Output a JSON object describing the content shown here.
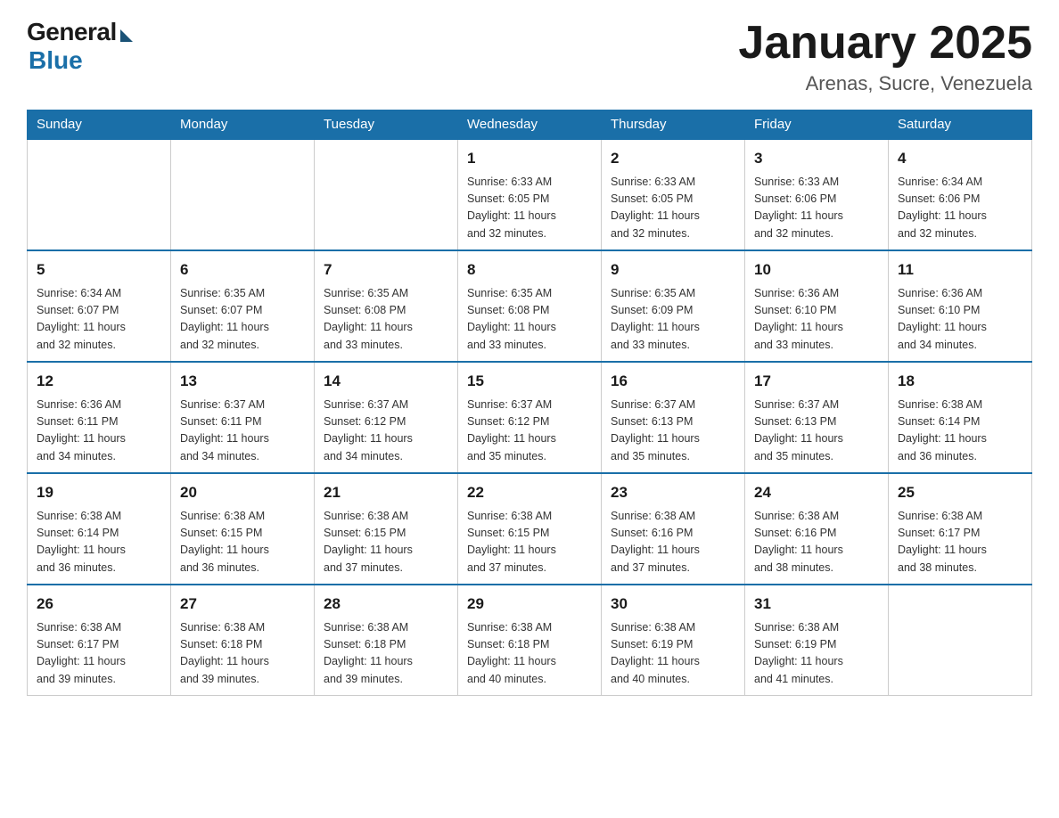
{
  "logo": {
    "general": "General",
    "blue": "Blue"
  },
  "title": "January 2025",
  "location": "Arenas, Sucre, Venezuela",
  "days_of_week": [
    "Sunday",
    "Monday",
    "Tuesday",
    "Wednesday",
    "Thursday",
    "Friday",
    "Saturday"
  ],
  "weeks": [
    [
      {
        "day": "",
        "info": ""
      },
      {
        "day": "",
        "info": ""
      },
      {
        "day": "",
        "info": ""
      },
      {
        "day": "1",
        "info": "Sunrise: 6:33 AM\nSunset: 6:05 PM\nDaylight: 11 hours\nand 32 minutes."
      },
      {
        "day": "2",
        "info": "Sunrise: 6:33 AM\nSunset: 6:05 PM\nDaylight: 11 hours\nand 32 minutes."
      },
      {
        "day": "3",
        "info": "Sunrise: 6:33 AM\nSunset: 6:06 PM\nDaylight: 11 hours\nand 32 minutes."
      },
      {
        "day": "4",
        "info": "Sunrise: 6:34 AM\nSunset: 6:06 PM\nDaylight: 11 hours\nand 32 minutes."
      }
    ],
    [
      {
        "day": "5",
        "info": "Sunrise: 6:34 AM\nSunset: 6:07 PM\nDaylight: 11 hours\nand 32 minutes."
      },
      {
        "day": "6",
        "info": "Sunrise: 6:35 AM\nSunset: 6:07 PM\nDaylight: 11 hours\nand 32 minutes."
      },
      {
        "day": "7",
        "info": "Sunrise: 6:35 AM\nSunset: 6:08 PM\nDaylight: 11 hours\nand 33 minutes."
      },
      {
        "day": "8",
        "info": "Sunrise: 6:35 AM\nSunset: 6:08 PM\nDaylight: 11 hours\nand 33 minutes."
      },
      {
        "day": "9",
        "info": "Sunrise: 6:35 AM\nSunset: 6:09 PM\nDaylight: 11 hours\nand 33 minutes."
      },
      {
        "day": "10",
        "info": "Sunrise: 6:36 AM\nSunset: 6:10 PM\nDaylight: 11 hours\nand 33 minutes."
      },
      {
        "day": "11",
        "info": "Sunrise: 6:36 AM\nSunset: 6:10 PM\nDaylight: 11 hours\nand 34 minutes."
      }
    ],
    [
      {
        "day": "12",
        "info": "Sunrise: 6:36 AM\nSunset: 6:11 PM\nDaylight: 11 hours\nand 34 minutes."
      },
      {
        "day": "13",
        "info": "Sunrise: 6:37 AM\nSunset: 6:11 PM\nDaylight: 11 hours\nand 34 minutes."
      },
      {
        "day": "14",
        "info": "Sunrise: 6:37 AM\nSunset: 6:12 PM\nDaylight: 11 hours\nand 34 minutes."
      },
      {
        "day": "15",
        "info": "Sunrise: 6:37 AM\nSunset: 6:12 PM\nDaylight: 11 hours\nand 35 minutes."
      },
      {
        "day": "16",
        "info": "Sunrise: 6:37 AM\nSunset: 6:13 PM\nDaylight: 11 hours\nand 35 minutes."
      },
      {
        "day": "17",
        "info": "Sunrise: 6:37 AM\nSunset: 6:13 PM\nDaylight: 11 hours\nand 35 minutes."
      },
      {
        "day": "18",
        "info": "Sunrise: 6:38 AM\nSunset: 6:14 PM\nDaylight: 11 hours\nand 36 minutes."
      }
    ],
    [
      {
        "day": "19",
        "info": "Sunrise: 6:38 AM\nSunset: 6:14 PM\nDaylight: 11 hours\nand 36 minutes."
      },
      {
        "day": "20",
        "info": "Sunrise: 6:38 AM\nSunset: 6:15 PM\nDaylight: 11 hours\nand 36 minutes."
      },
      {
        "day": "21",
        "info": "Sunrise: 6:38 AM\nSunset: 6:15 PM\nDaylight: 11 hours\nand 37 minutes."
      },
      {
        "day": "22",
        "info": "Sunrise: 6:38 AM\nSunset: 6:15 PM\nDaylight: 11 hours\nand 37 minutes."
      },
      {
        "day": "23",
        "info": "Sunrise: 6:38 AM\nSunset: 6:16 PM\nDaylight: 11 hours\nand 37 minutes."
      },
      {
        "day": "24",
        "info": "Sunrise: 6:38 AM\nSunset: 6:16 PM\nDaylight: 11 hours\nand 38 minutes."
      },
      {
        "day": "25",
        "info": "Sunrise: 6:38 AM\nSunset: 6:17 PM\nDaylight: 11 hours\nand 38 minutes."
      }
    ],
    [
      {
        "day": "26",
        "info": "Sunrise: 6:38 AM\nSunset: 6:17 PM\nDaylight: 11 hours\nand 39 minutes."
      },
      {
        "day": "27",
        "info": "Sunrise: 6:38 AM\nSunset: 6:18 PM\nDaylight: 11 hours\nand 39 minutes."
      },
      {
        "day": "28",
        "info": "Sunrise: 6:38 AM\nSunset: 6:18 PM\nDaylight: 11 hours\nand 39 minutes."
      },
      {
        "day": "29",
        "info": "Sunrise: 6:38 AM\nSunset: 6:18 PM\nDaylight: 11 hours\nand 40 minutes."
      },
      {
        "day": "30",
        "info": "Sunrise: 6:38 AM\nSunset: 6:19 PM\nDaylight: 11 hours\nand 40 minutes."
      },
      {
        "day": "31",
        "info": "Sunrise: 6:38 AM\nSunset: 6:19 PM\nDaylight: 11 hours\nand 41 minutes."
      },
      {
        "day": "",
        "info": ""
      }
    ]
  ]
}
